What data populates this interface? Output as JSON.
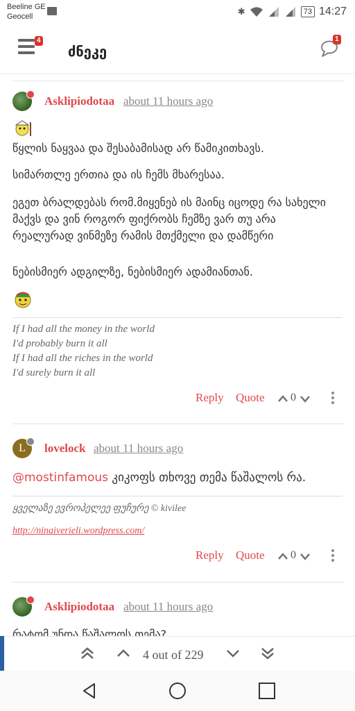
{
  "status_bar": {
    "carrier_line1": "Beeline GE",
    "carrier_line2": "Geocell",
    "battery": "73",
    "time": "14:27",
    "icons": [
      "gallery-icon",
      "bluetooth-icon",
      "wifi-icon",
      "signal-icon",
      "battery-icon"
    ]
  },
  "app_bar": {
    "title": "ძნეკე",
    "menu_badge": "4",
    "chat_badge": "1"
  },
  "posts": [
    {
      "username": "Asklipiodotaa",
      "time": "about 11 hours ago",
      "status_color": "#e0474c",
      "paragraphs": [
        "წყლის ნაყვაა და შესაბამისად არ წამიკითხავს.",
        "სიმართლე ერთია და ის ჩემს მხარესაა.",
        "ეგეთ ბრალდებას რომ.მიყენებ ის მაინც იცოდე რა სახელი მაქვს და ვინ როგორ ფიქრობს ჩემზე ვარ თუ არა რეალურად ვინმეზე რამის მთქმელი და დამწერი",
        "ნებისმიერ ადგილზე, ნებისმიერ ადამიანთან."
      ],
      "signature": [
        "If I had all the money in the world",
        "I'd probably burn it all",
        "If I had all the riches in the world",
        "I'd surely burn it all"
      ],
      "actions": {
        "reply": "Reply",
        "quote": "Quote",
        "votes": "0"
      }
    },
    {
      "username": "lovelock",
      "avatar_letter": "L",
      "time": "about 11 hours ago",
      "status_color": "#888888",
      "mention": "@mostinfamous",
      "text": " კიკოფს თხოვე თემა წაშალოს რა.",
      "signature_line": "ყველაზე ევროპელეე ფუჩურე © kivilee",
      "signature_link": "http://ninaiverieli.wordpress.com/",
      "actions": {
        "reply": "Reply",
        "quote": "Quote",
        "votes": "0"
      }
    },
    {
      "username": "Asklipiodotaa",
      "time": "about 11 hours ago",
      "status_color": "#e0474c",
      "partial_text": "რატომ უნდა წაშალოს თემა?"
    }
  ],
  "pager": {
    "text": "4 out of 229",
    "icons": [
      "double-chevron-up-icon",
      "chevron-up-icon",
      "chevron-down-icon",
      "double-chevron-down-icon"
    ]
  },
  "nav_bar": {
    "icons": [
      "back-icon",
      "home-icon",
      "recents-icon"
    ]
  }
}
